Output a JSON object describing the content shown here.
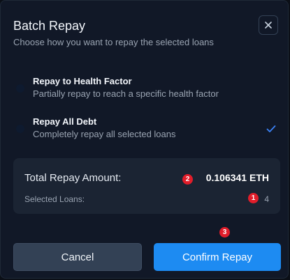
{
  "modal": {
    "title": "Batch Repay",
    "subtitle": "Choose how you want to repay the selected loans",
    "close_icon": "close-icon"
  },
  "options": [
    {
      "label": "Repay to Health Factor",
      "description": "Partially repay to reach a specific health factor",
      "selected": false
    },
    {
      "label": "Repay All Debt",
      "description": "Completely repay all selected loans",
      "selected": true
    }
  ],
  "summary": {
    "total_label": "Total Repay Amount:",
    "total_value": "0.106341 ETH",
    "loans_label": "Selected Loans:",
    "loans_value": "4"
  },
  "badges": {
    "loans": "1",
    "total": "2",
    "confirm": "3"
  },
  "buttons": {
    "cancel": "Cancel",
    "confirm": "Confirm Repay"
  },
  "colors": {
    "accent": "#1d8bf2",
    "badge": "#e11d2a",
    "check": "#3b82f6"
  }
}
